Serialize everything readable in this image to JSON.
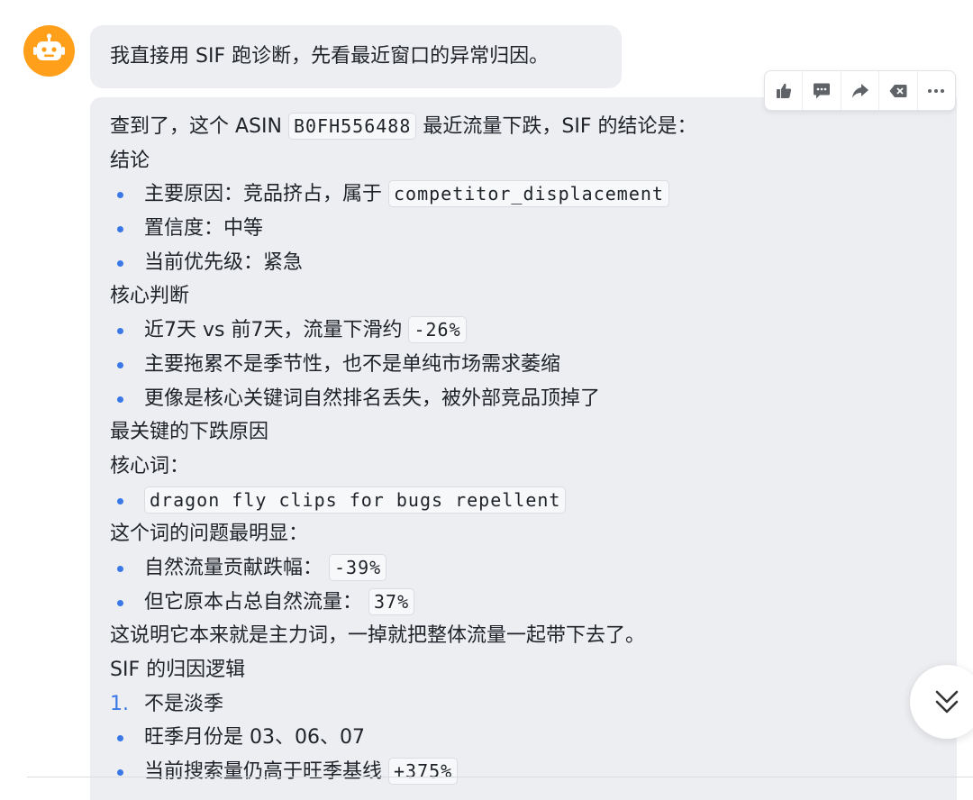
{
  "user_message": "我直接用 SIF 跑诊断，先看最近窗口的异常归因。",
  "toolbar": {
    "icons": [
      "thumbs-up-icon",
      "comment-icon",
      "share-icon",
      "backspace-icon",
      "more-icon"
    ]
  },
  "response": {
    "intro_prefix": "查到了，这个 ASIN",
    "asin": "B0FH556488",
    "intro_suffix": "最近流量下跌，SIF 的结论是：",
    "h_conclusion": "结论",
    "c1_prefix": "主要原因：竞品挤占，属于",
    "c1_code": "competitor_displacement",
    "c2": "置信度：中等",
    "c3": "当前优先级：紧急",
    "h_core": "核心判断",
    "j1_prefix": "近7天 vs 前7天，流量下滑约",
    "j1_code": "-26%",
    "j2": "主要拖累不是季节性，也不是单纯市场需求萎缩",
    "j3": "更像是核心关键词自然排名丢失，被外部竞品顶掉了",
    "h_reason": "最关键的下跌原因",
    "kw_label": "核心词：",
    "kw_code": "dragon fly clips for bugs repellent",
    "kw_problem": "这个词的问题最明显：",
    "p1_prefix": "自然流量贡献跌幅：",
    "p1_code": "-39%",
    "p2_prefix": "但它原本占总自然流量：",
    "p2_code": "37%",
    "explain": "这说明它本来就是主力词，一掉就把整体流量一起带下去了。",
    "h_logic": "SIF 的归因逻辑",
    "l1_num": "1.",
    "l1": "不是淡季",
    "l2": "旺季月份是 03、06、07",
    "l3_prefix": "当前搜索量仍高于旺季基线",
    "l3_code": "+375%"
  }
}
